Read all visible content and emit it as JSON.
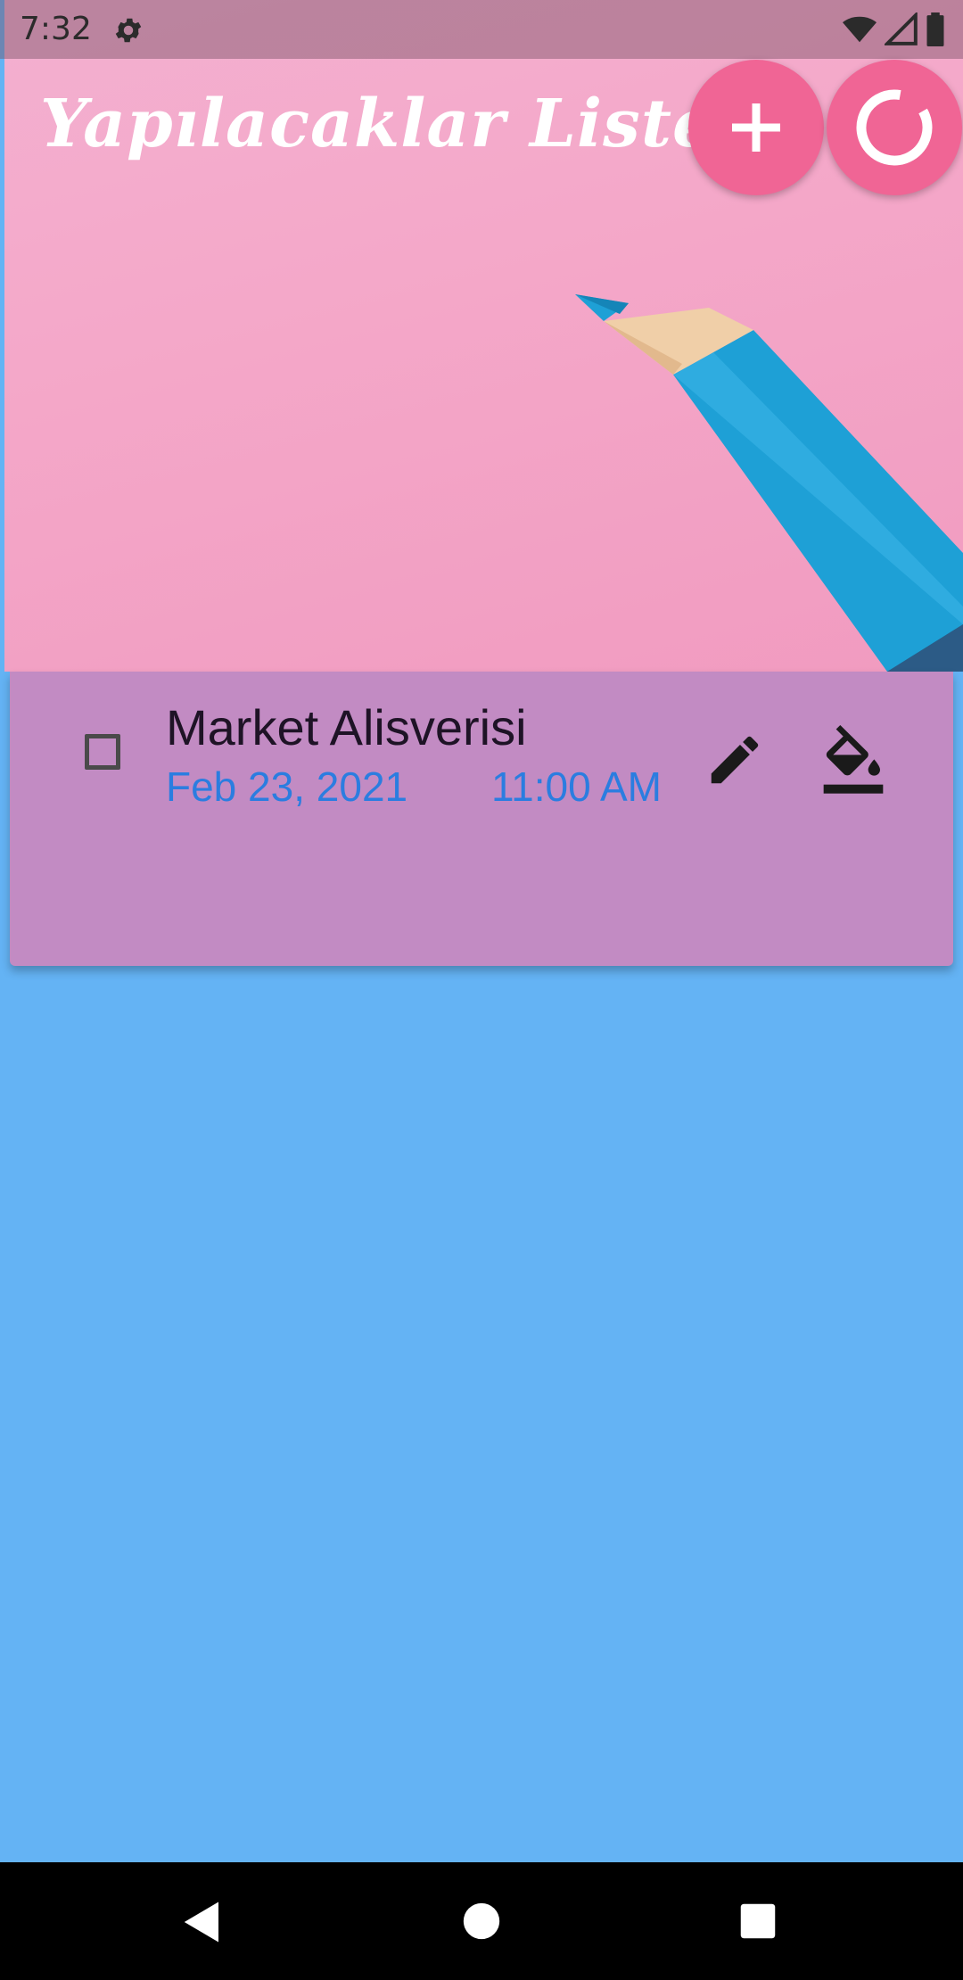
{
  "status_bar": {
    "time": "7:32",
    "icons": [
      "gear-icon",
      "wifi-icon",
      "signal-icon",
      "battery-icon"
    ]
  },
  "header": {
    "title": "Yapılacaklar Listesi",
    "add_button_icon": "plus-icon",
    "refresh_button_icon": "refresh-icon"
  },
  "tasks": [
    {
      "title": "Market Alisverisi",
      "date": "Feb 23, 2021",
      "time": "11:00 AM",
      "done": false
    }
  ],
  "colors": {
    "background": "#64b3f4",
    "card": "#c28bc3",
    "fab": "#f06595",
    "date_text": "#2b7de0",
    "header_pink": "#f4a8c9",
    "pencil_blue": "#1ea0d6"
  },
  "nav_bar": {
    "icons": [
      "back-icon",
      "home-icon",
      "recents-icon"
    ]
  }
}
